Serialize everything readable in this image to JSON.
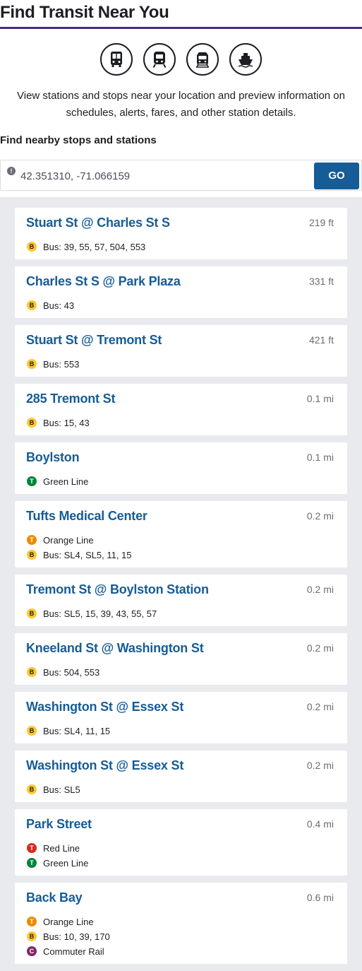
{
  "header": {
    "title": "Find Transit Near You"
  },
  "modes": [
    {
      "icon": "bus-icon"
    },
    {
      "icon": "subway-icon"
    },
    {
      "icon": "commuter-rail-icon"
    },
    {
      "icon": "ferry-icon"
    }
  ],
  "intro": "View stations and stops near your location and preview information on schedules, alerts, fares, and other station details.",
  "search": {
    "label": "Find nearby stops and stations",
    "value": "42.351310, -71.066159",
    "go_label": "GO"
  },
  "colors": {
    "accent": "#4c2a86",
    "link": "#165c96",
    "bus": "#ffc72c",
    "green_line": "#00843d",
    "orange_line": "#ed8b00",
    "red_line": "#da291c",
    "commuter_rail": "#80276c"
  },
  "stops": [
    {
      "name": "Stuart St @ Charles St S",
      "distance": "219 ft",
      "routes": [
        {
          "type": "bus",
          "text": "Bus: 39, 55, 57, 504, 553"
        }
      ]
    },
    {
      "name": "Charles St S @ Park Plaza",
      "distance": "331 ft",
      "routes": [
        {
          "type": "bus",
          "text": "Bus: 43"
        }
      ]
    },
    {
      "name": "Stuart St @ Tremont St",
      "distance": "421 ft",
      "routes": [
        {
          "type": "bus",
          "text": "Bus: 553"
        }
      ]
    },
    {
      "name": "285 Tremont St",
      "distance": "0.1 mi",
      "routes": [
        {
          "type": "bus",
          "text": "Bus: 15, 43"
        }
      ]
    },
    {
      "name": "Boylston",
      "distance": "0.1 mi",
      "routes": [
        {
          "type": "green",
          "text": "Green Line"
        }
      ]
    },
    {
      "name": "Tufts Medical Center",
      "distance": "0.2 mi",
      "routes": [
        {
          "type": "orange",
          "text": "Orange Line"
        },
        {
          "type": "bus",
          "text": "Bus: SL4, SL5, 11, 15"
        }
      ]
    },
    {
      "name": "Tremont St @ Boylston Station",
      "distance": "0.2 mi",
      "routes": [
        {
          "type": "bus",
          "text": "Bus: SL5, 15, 39, 43, 55, 57"
        }
      ]
    },
    {
      "name": "Kneeland St @ Washington St",
      "distance": "0.2 mi",
      "routes": [
        {
          "type": "bus",
          "text": "Bus: 504, 553"
        }
      ]
    },
    {
      "name": "Washington St @ Essex St",
      "distance": "0.2 mi",
      "routes": [
        {
          "type": "bus",
          "text": "Bus: SL4, 11, 15"
        }
      ]
    },
    {
      "name": "Washington St @ Essex St",
      "distance": "0.2 mi",
      "routes": [
        {
          "type": "bus",
          "text": "Bus: SL5"
        }
      ]
    },
    {
      "name": "Park Street",
      "distance": "0.4 mi",
      "routes": [
        {
          "type": "red",
          "text": "Red Line"
        },
        {
          "type": "green",
          "text": "Green Line"
        }
      ]
    },
    {
      "name": "Back Bay",
      "distance": "0.6 mi",
      "routes": [
        {
          "type": "orange",
          "text": "Orange Line"
        },
        {
          "type": "bus",
          "text": "Bus: 10, 39, 170"
        },
        {
          "type": "cr",
          "text": "Commuter Rail"
        }
      ]
    }
  ]
}
